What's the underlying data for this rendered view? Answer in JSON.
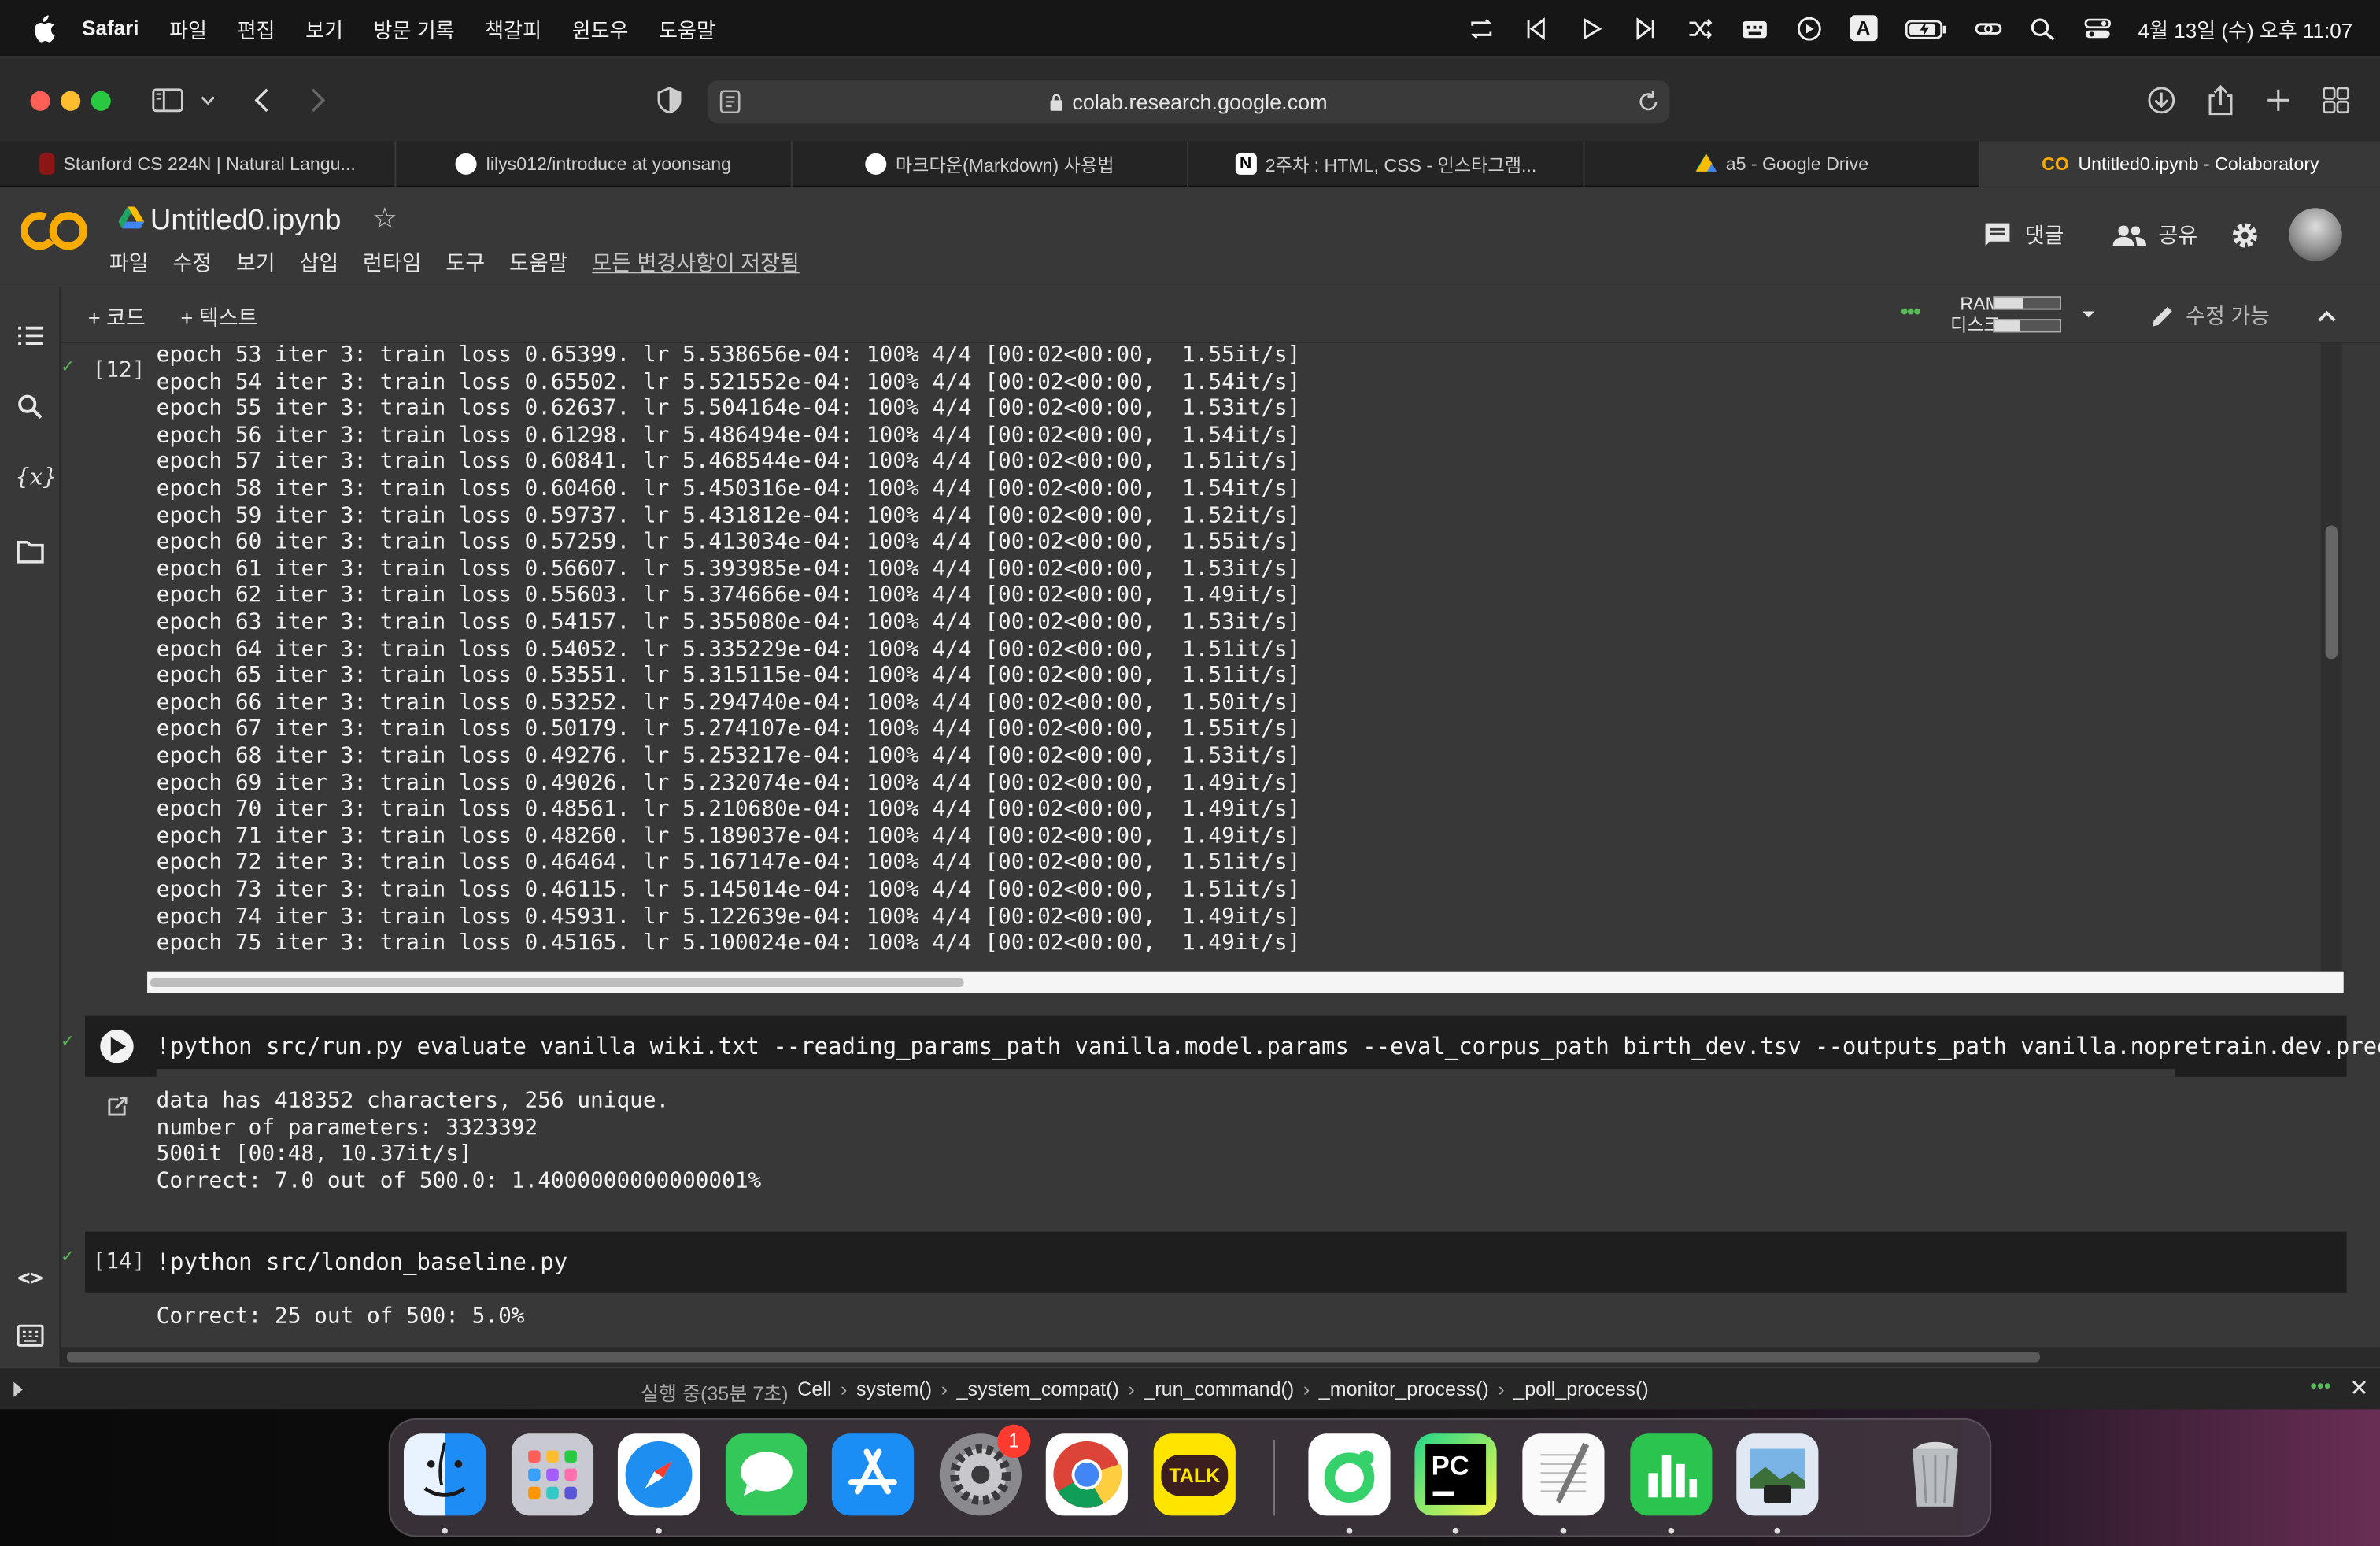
{
  "menubar": {
    "app": "Safari",
    "items": [
      "파일",
      "편집",
      "보기",
      "방문 기록",
      "책갈피",
      "윈도우",
      "도움말"
    ],
    "clock": "4월 13일 (수) 오후 11:07",
    "input_source": "A"
  },
  "browser": {
    "url": "colab.research.google.com",
    "tabs": [
      {
        "label": "Stanford CS 224N | Natural Langu...",
        "active": false,
        "favicon_color": "#8c1515"
      },
      {
        "label": "lilys012/introduce at yoonsang",
        "active": false,
        "favicon_color": "#ffffff"
      },
      {
        "label": "마크다운(Markdown) 사용법",
        "active": false,
        "favicon_color": "#ffffff"
      },
      {
        "label": "2주차 : HTML, CSS - 인스타그램...",
        "active": false,
        "favicon_color": "#ffffff"
      },
      {
        "label": "a5 - Google Drive",
        "active": false,
        "favicon_color": "#fbbc04"
      },
      {
        "label": "Untitled0.ipynb - Colaboratory",
        "active": true,
        "favicon_color": "#f9ab00"
      }
    ]
  },
  "colab": {
    "logo_text": "CO",
    "title": "Untitled0.ipynb",
    "menu": [
      "파일",
      "수정",
      "보기",
      "삽입",
      "런타임",
      "도구",
      "도움말"
    ],
    "saved_status": "모든 변경사항이 저장됨",
    "comment_label": "댓글",
    "share_label": "공유",
    "add_code": "+ 코드",
    "add_text": "+ 텍스트",
    "ram_label": "RAM",
    "disk_label": "디스크",
    "edit_mode": "수정 가능"
  },
  "cells": {
    "cell12": {
      "number": "[12]",
      "log": [
        "epoch 53 iter 3: train loss 0.65399. lr 5.538656e-04: 100% 4/4 [00:02<00:00,  1.55it/s]",
        "epoch 54 iter 3: train loss 0.65502. lr 5.521552e-04: 100% 4/4 [00:02<00:00,  1.54it/s]",
        "epoch 55 iter 3: train loss 0.62637. lr 5.504164e-04: 100% 4/4 [00:02<00:00,  1.53it/s]",
        "epoch 56 iter 3: train loss 0.61298. lr 5.486494e-04: 100% 4/4 [00:02<00:00,  1.54it/s]",
        "epoch 57 iter 3: train loss 0.60841. lr 5.468544e-04: 100% 4/4 [00:02<00:00,  1.51it/s]",
        "epoch 58 iter 3: train loss 0.60460. lr 5.450316e-04: 100% 4/4 [00:02<00:00,  1.54it/s]",
        "epoch 59 iter 3: train loss 0.59737. lr 5.431812e-04: 100% 4/4 [00:02<00:00,  1.52it/s]",
        "epoch 60 iter 3: train loss 0.57259. lr 5.413034e-04: 100% 4/4 [00:02<00:00,  1.55it/s]",
        "epoch 61 iter 3: train loss 0.56607. lr 5.393985e-04: 100% 4/4 [00:02<00:00,  1.53it/s]",
        "epoch 62 iter 3: train loss 0.55603. lr 5.374666e-04: 100% 4/4 [00:02<00:00,  1.49it/s]",
        "epoch 63 iter 3: train loss 0.54157. lr 5.355080e-04: 100% 4/4 [00:02<00:00,  1.53it/s]",
        "epoch 64 iter 3: train loss 0.54052. lr 5.335229e-04: 100% 4/4 [00:02<00:00,  1.51it/s]",
        "epoch 65 iter 3: train loss 0.53551. lr 5.315115e-04: 100% 4/4 [00:02<00:00,  1.51it/s]",
        "epoch 66 iter 3: train loss 0.53252. lr 5.294740e-04: 100% 4/4 [00:02<00:00,  1.50it/s]",
        "epoch 67 iter 3: train loss 0.50179. lr 5.274107e-04: 100% 4/4 [00:02<00:00,  1.55it/s]",
        "epoch 68 iter 3: train loss 0.49276. lr 5.253217e-04: 100% 4/4 [00:02<00:00,  1.53it/s]",
        "epoch 69 iter 3: train loss 0.49026. lr 5.232074e-04: 100% 4/4 [00:02<00:00,  1.49it/s]",
        "epoch 70 iter 3: train loss 0.48561. lr 5.210680e-04: 100% 4/4 [00:02<00:00,  1.49it/s]",
        "epoch 71 iter 3: train loss 0.48260. lr 5.189037e-04: 100% 4/4 [00:02<00:00,  1.49it/s]",
        "epoch 72 iter 3: train loss 0.46464. lr 5.167147e-04: 100% 4/4 [00:02<00:00,  1.51it/s]",
        "epoch 73 iter 3: train loss 0.46115. lr 5.145014e-04: 100% 4/4 [00:02<00:00,  1.51it/s]",
        "epoch 74 iter 3: train loss 0.45931. lr 5.122639e-04: 100% 4/4 [00:02<00:00,  1.49it/s]",
        "epoch 75 iter 3: train loss 0.45165. lr 5.100024e-04: 100% 4/4 [00:02<00:00,  1.49it/s]"
      ]
    },
    "cell13": {
      "code": "!python src/run.py evaluate vanilla wiki.txt --reading_params_path vanilla.model.params --eval_corpus_path birth_dev.tsv --outputs_path vanilla.nopretrain.dev.predi",
      "output": [
        "data has 418352 characters, 256 unique.",
        "number of parameters: 3323392",
        "500it [00:48, 10.37it/s]",
        "Correct: 7.0 out of 500.0: 1.4000000000000001%"
      ]
    },
    "cell14": {
      "number": "[14]",
      "code": "!python src/london_baseline.py",
      "output": "Correct: 25 out of 500: 5.0%"
    }
  },
  "statusbar": {
    "running": "실행 중(35분 7초)",
    "breadcrumbs": [
      "Cell",
      "system()",
      "_system_compat()",
      "_run_command()",
      "_monitor_process()",
      "_poll_process()"
    ]
  },
  "dock": {
    "apps": [
      "Finder",
      "Launchpad",
      "Safari",
      "Messages",
      "App Store",
      "System Preferences",
      "Chrome",
      "KakaoTalk",
      "Camo",
      "PyCharm",
      "TextEdit",
      "Numbers",
      "Preview",
      "Trash"
    ],
    "settings_badge": "1",
    "kakao_label": "TALK",
    "pycharm_label": "PC"
  }
}
